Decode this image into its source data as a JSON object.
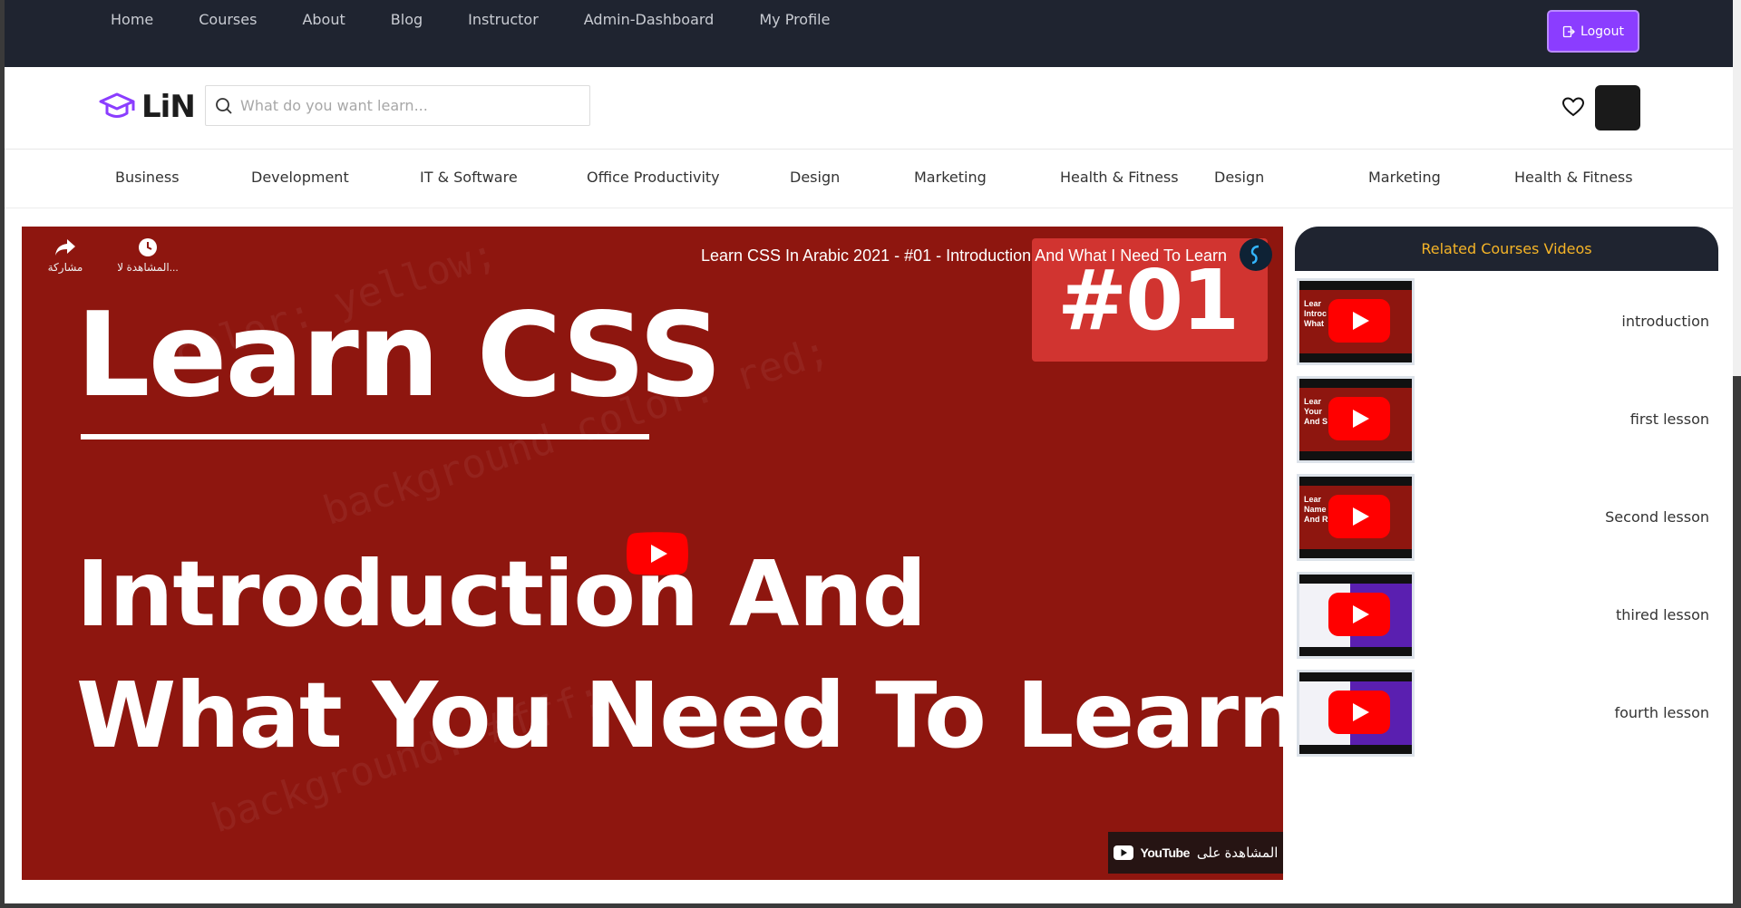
{
  "topbar": {
    "nav": [
      "Home",
      "Courses",
      "About",
      "Blog",
      "Instructor",
      "Admin-Dashboard",
      "My Profile"
    ],
    "logout_label": "Logout"
  },
  "header": {
    "logo_text": "LiN",
    "search_placeholder": "What do you want learn..."
  },
  "categories": [
    "Business",
    "Development",
    "IT & Software",
    "Office Productivity",
    "Design",
    "Marketing",
    "Health & Fitness",
    "Design",
    "Marketing",
    "Health & Fitness"
  ],
  "video": {
    "title": "Learn CSS In Arabic 2021 - #01 - Introduction And What I Need To Learn",
    "share_label": "مشاركة",
    "watch_later_label": "المشاهدة لا...",
    "thumb_title": "Learn CSS",
    "thumb_episode": "#01",
    "thumb_line2": "Introduction And",
    "thumb_line3": "What You Need To Learn",
    "watch_on_label": "المشاهدة على",
    "youtube_label": "YouTube"
  },
  "related": {
    "heading": "Related Courses Videos",
    "items": [
      {
        "label": "introduction",
        "thumb": "red"
      },
      {
        "label": "first lesson",
        "thumb": "red"
      },
      {
        "label": "Second lesson",
        "thumb": "red"
      },
      {
        "label": "thired lesson",
        "thumb": "purple"
      },
      {
        "label": "fourth lesson",
        "thumb": "purple"
      }
    ]
  },
  "colors": {
    "topbar": "#1f2430",
    "accent": "#8b3dff",
    "related_heading_text": "#f5b427",
    "video_bg": "#8e160f"
  }
}
